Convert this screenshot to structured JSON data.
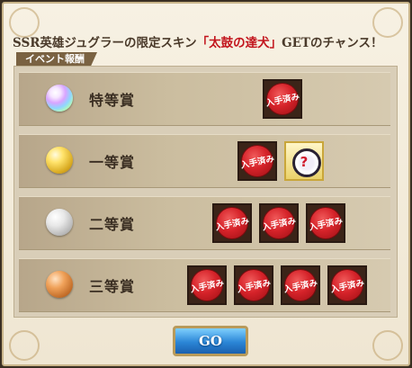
{
  "headline": {
    "prefix": "SSR英雄ジュグラーの限定スキン",
    "highlight": "「太鼓の達犬」",
    "suffix": "GETのチャンス！",
    "highlight_color": "#c2141c"
  },
  "section_label": "イベント報酬",
  "prizes": [
    {
      "rank": "特等賞",
      "orb": "rainbow-orb",
      "items": [
        {
          "type": "obtained",
          "label": "入手済み"
        }
      ]
    },
    {
      "rank": "一等賞",
      "orb": "gold-orb",
      "items": [
        {
          "type": "obtained",
          "label": "入手済み"
        },
        {
          "type": "mystery",
          "label": "?"
        }
      ]
    },
    {
      "rank": "二等賞",
      "orb": "silver-orb",
      "items": [
        {
          "type": "obtained",
          "label": "入手済み"
        },
        {
          "type": "obtained",
          "label": "入手済み"
        },
        {
          "type": "obtained",
          "label": "入手済み"
        }
      ]
    },
    {
      "rank": "三等賞",
      "orb": "bronze-orb",
      "items": [
        {
          "type": "obtained",
          "label": "入手済み"
        },
        {
          "type": "obtained",
          "label": "入手済み"
        },
        {
          "type": "obtained",
          "label": "入手済み"
        },
        {
          "type": "obtained",
          "label": "入手済み"
        }
      ]
    }
  ],
  "go_button": {
    "label": "GO"
  }
}
